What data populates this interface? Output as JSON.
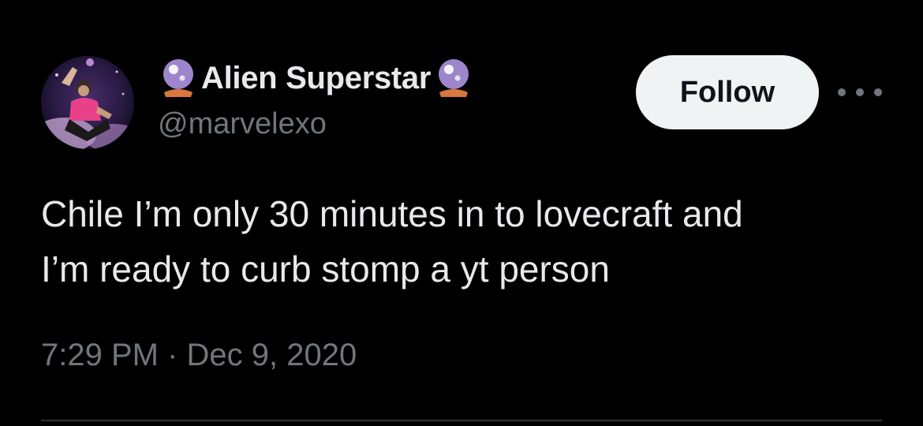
{
  "author": {
    "display_name": "Alien Superstar",
    "handle": "@marvelexo",
    "name_emoji": "crystal-ball-icon",
    "avatar": "profile-photo"
  },
  "actions": {
    "follow_label": "Follow",
    "more_icon": "more-options-icon"
  },
  "tweet": {
    "text_lines": [
      "Chile I’m only 30 minutes in to lovecraft and",
      "I’m ready to curb stomp a yt person"
    ],
    "timestamp": "7:29 PM · Dec 9, 2020"
  },
  "colors": {
    "background": "#000000",
    "primary_text": "#e7e9ea",
    "secondary_text": "#71767b",
    "follow_bg": "#eff3f4",
    "divider": "#2f3336"
  }
}
